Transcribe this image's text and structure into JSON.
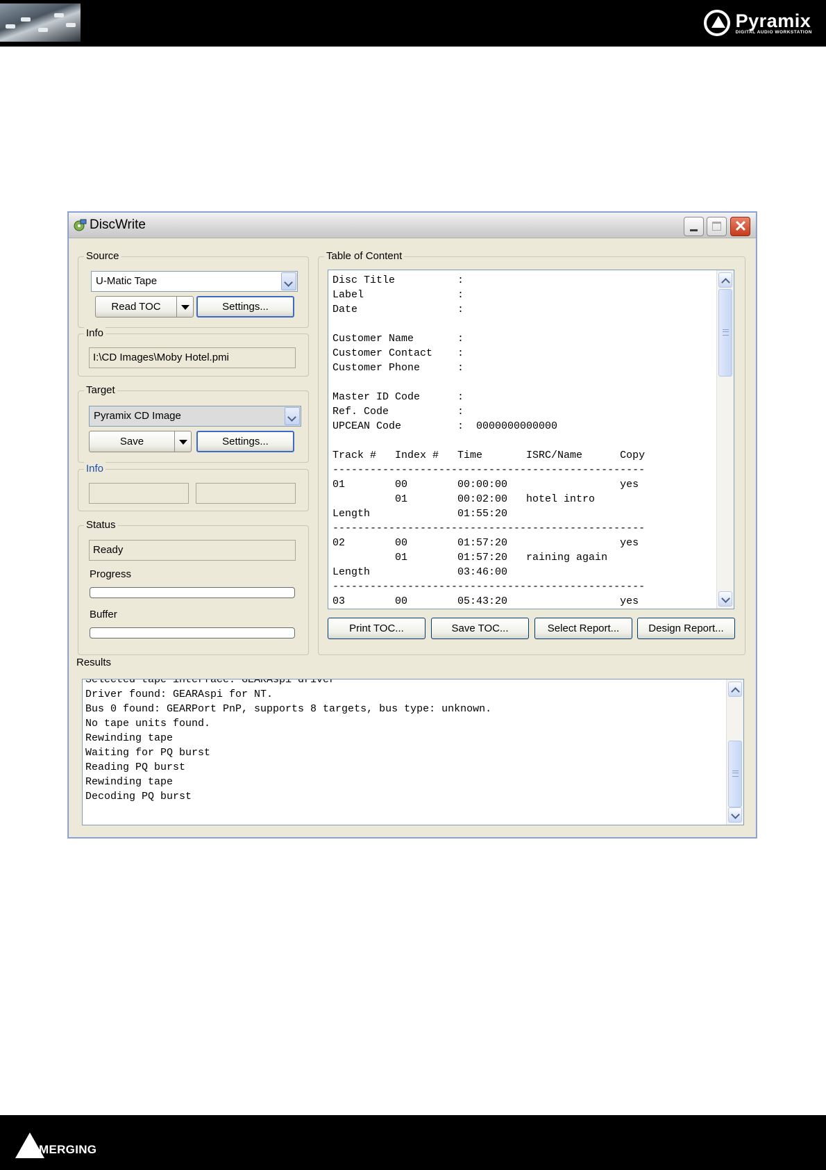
{
  "page": {
    "brand_name": "Pyramix",
    "brand_subtitle": "DIGITAL AUDIO WORKSTATION",
    "footer_brand": "MERGING"
  },
  "window": {
    "title": "DiscWrite"
  },
  "source": {
    "legend": "Source",
    "selected": "U-Matic Tape",
    "read_toc_label": "Read TOC",
    "settings_label": "Settings..."
  },
  "source_info": {
    "legend": "Info",
    "path": "I:\\CD Images\\Moby Hotel.pmi"
  },
  "target": {
    "legend": "Target",
    "selected": "Pyramix CD Image",
    "save_label": "Save",
    "settings_label": "Settings..."
  },
  "target_info": {
    "legend": "Info",
    "value_left": "",
    "value_right": ""
  },
  "status": {
    "legend": "Status",
    "value": "Ready",
    "progress_label": "Progress",
    "progress": 0,
    "buffer_label": "Buffer",
    "buffer": 0
  },
  "toc": {
    "legend": "Table of Content",
    "lines": [
      "Disc Title          :",
      "Label               :",
      "Date                :",
      "",
      "Customer Name       :",
      "Customer Contact    :",
      "Customer Phone      :",
      "",
      "Master ID Code      :",
      "Ref. Code           :",
      "UPCEAN Code         :  0000000000000",
      "",
      "Track #   Index #   Time       ISRC/Name      Copy",
      "--------------------------------------------------",
      "01        00        00:00:00                  yes",
      "          01        00:02:00   hotel intro",
      "Length              01:55:20",
      "--------------------------------------------------",
      "02        00        01:57:20                  yes",
      "          01        01:57:20   raining again",
      "Length              03:46:00",
      "--------------------------------------------------",
      "03        00        05:43:20                  yes"
    ],
    "print_label": "Print TOC...",
    "save_label": "Save TOC...",
    "select_report_label": "Select Report...",
    "design_report_label": "Design Report..."
  },
  "results": {
    "label": "Results",
    "lines": [
      "Selected tape interface: GEARAspi driver",
      "Driver found: GEARAspi for NT.",
      "Bus 0 found: GEARPort PnP, supports 8 targets, bus type: unknown.",
      "No tape units found.",
      "Rewinding tape",
      "Waiting for PQ burst",
      "Reading PQ burst",
      "Rewinding tape",
      "Decoding PQ burst"
    ]
  }
}
